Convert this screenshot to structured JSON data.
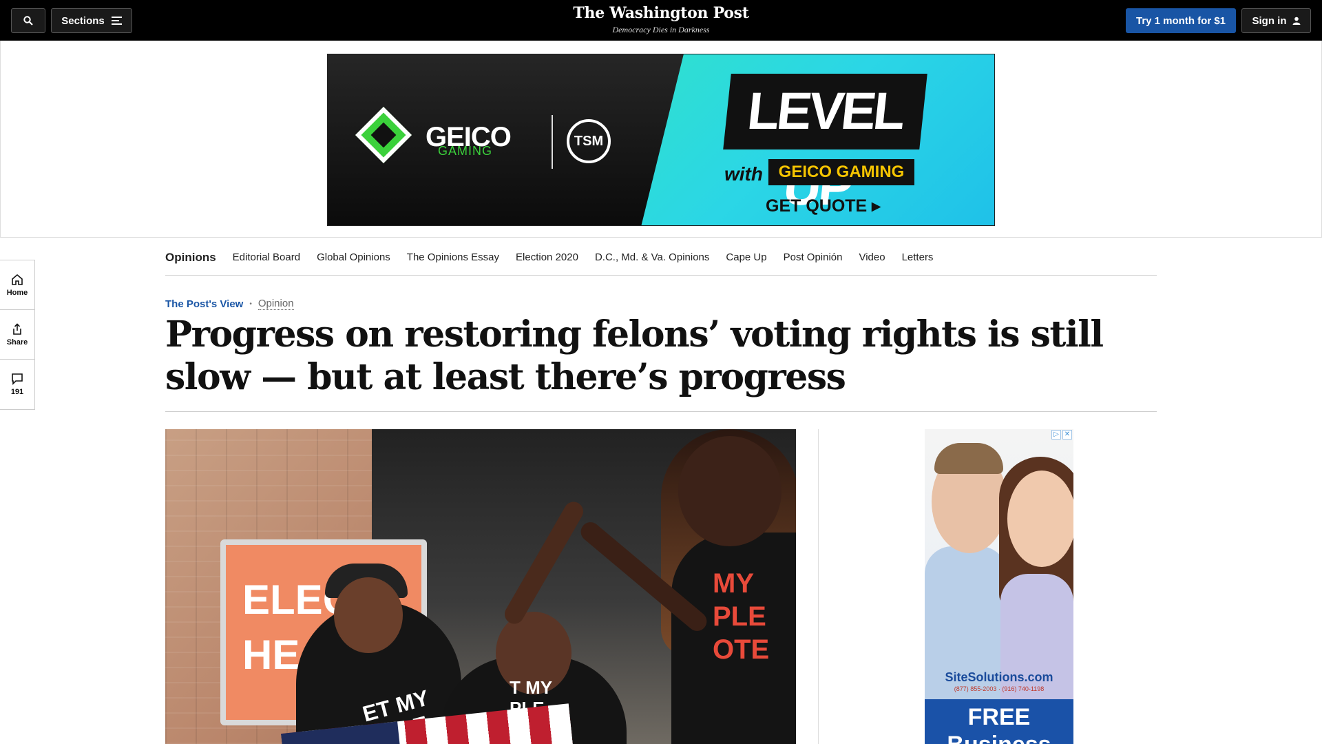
{
  "topbar": {
    "sections_label": "Sections",
    "logo": "The Washington Post",
    "tagline": "Democracy Dies in Darkness",
    "try_label": "Try 1 month for $1",
    "signin_label": "Sign in",
    "accent_color": "#1955a5"
  },
  "banner_ad": {
    "geico_word": "GEICO",
    "geico_sub": "GAMING",
    "tsm": "TSM",
    "level_up": "LEVEL UP",
    "with": "with",
    "geico_gaming": "GEICO GAMING",
    "get_quote": "GET QUOTE ▸"
  },
  "rail": {
    "home": "Home",
    "share": "Share",
    "comments_count": "191"
  },
  "secnav": {
    "items": [
      "Opinions",
      "Editorial Board",
      "Global Opinions",
      "The Opinions Essay",
      "Election 2020",
      "D.C., Md. & Va. Opinions",
      "Cape Up",
      "Post Opinión",
      "Video",
      "Letters"
    ]
  },
  "article": {
    "kicker_view": "The Post's View",
    "kicker_dot": "•",
    "kicker_label": "Opinion",
    "headline": "Progress on restoring felons’ voting rights is still slow — but at least there’s progress"
  },
  "photo": {
    "sign_text": "ELEC HEADQ",
    "shirt_a": "T MY PLE",
    "shirt_b": "MY PLE OTE",
    "shirt_c": "ET MY OPLE"
  },
  "side_ad": {
    "brand": "SiteSolutions.com",
    "phones": "(877) 855-2003 · (916) 740-1198",
    "headline": "FREE Business"
  }
}
